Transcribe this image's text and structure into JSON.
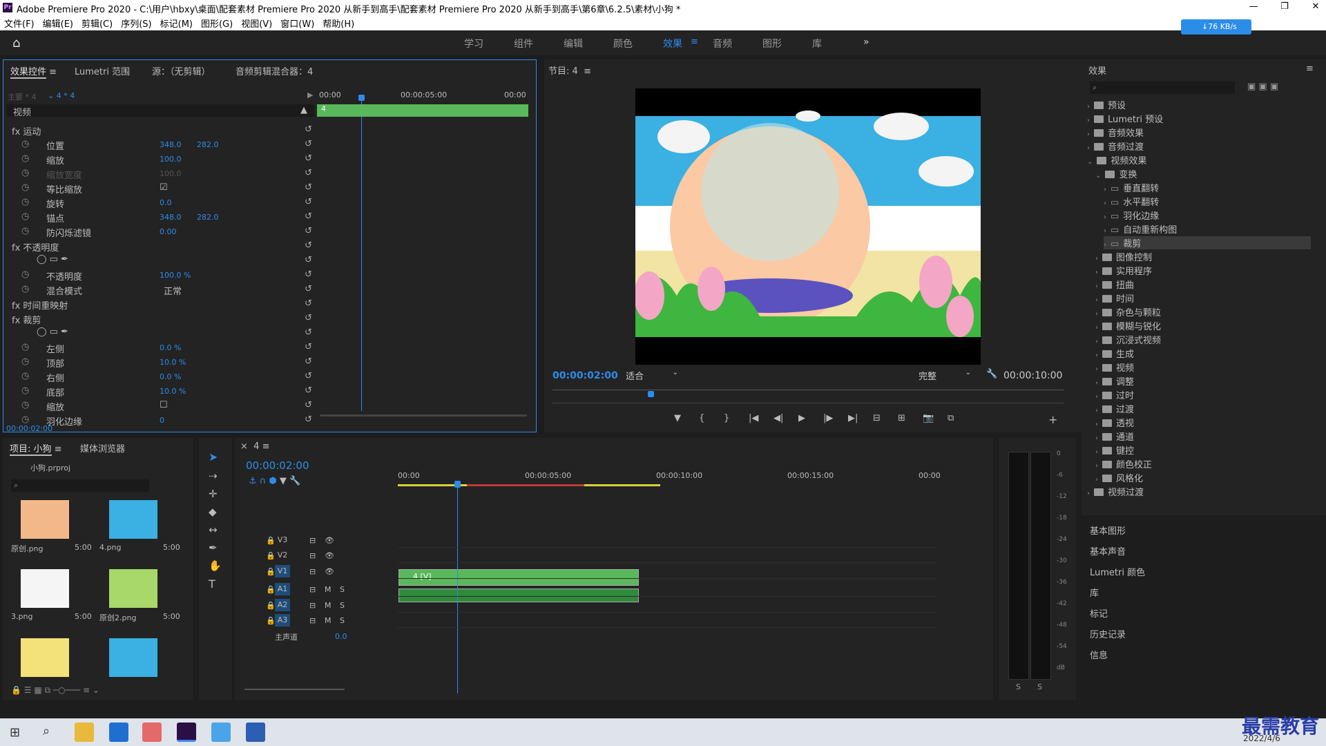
{
  "window": {
    "title": "Adobe Premiere Pro 2020 - C:\\用户\\hbxy\\桌面\\配套素材 Premiere Pro 2020 从新手到高手\\配套素材 Premiere Pro 2020 从新手到高手\\第6章\\6.2.5\\素材\\小狗 *",
    "logo": "Pr"
  },
  "menu": [
    "文件(F)",
    "编辑(E)",
    "剪辑(C)",
    "序列(S)",
    "标记(M)",
    "图形(G)",
    "视图(V)",
    "窗口(W)",
    "帮助(H)"
  ],
  "workspaces": [
    "学习",
    "组件",
    "编辑",
    "颜色",
    "效果",
    "音频",
    "图形",
    "库"
  ],
  "workspace_active": "效果",
  "workspace_menu_glyph": "≡",
  "more_glyph": "»",
  "net_speed": "↓76 KB/s",
  "effect_controls": {
    "tabs": [
      "效果控件",
      "Lumetri 范围",
      "源：（无剪辑）",
      "音频剪辑混合器：4"
    ],
    "tab_menu_glyph": "≡",
    "master_label": "主要 * 4",
    "clip_label": "4 * 4",
    "section_video": "视频",
    "timecodes": [
      "00:00",
      "00:00:05:00",
      "00:00"
    ],
    "clip_bar_label": "4",
    "rows": [
      {
        "name": "fx 运动",
        "indent": 0
      },
      {
        "name": "位置",
        "v1": "348.0",
        "v2": "282.0"
      },
      {
        "name": "缩放",
        "v1": "100.0"
      },
      {
        "name": "缩放宽度",
        "v1": "100.0",
        "dim": true
      },
      {
        "name": "等比缩放",
        "check": true
      },
      {
        "name": "旋转",
        "v1": "0.0"
      },
      {
        "name": "锚点",
        "v1": "348.0",
        "v2": "282.0"
      },
      {
        "name": "防闪烁滤镜",
        "v1": "0.00"
      },
      {
        "name": "fx 不透明度",
        "indent": 0
      },
      {
        "name": "",
        "shapes": true
      },
      {
        "name": "不透明度",
        "v1": "100.0 %"
      },
      {
        "name": "混合模式",
        "select": "正常"
      },
      {
        "name": "fx 时间重映射",
        "indent": 0
      },
      {
        "name": "fx 裁剪",
        "indent": 0
      },
      {
        "name": "",
        "shapes": true
      },
      {
        "name": "左侧",
        "v1": "0.0 %"
      },
      {
        "name": "顶部",
        "v1": "10.0 %"
      },
      {
        "name": "右侧",
        "v1": "0.0 %"
      },
      {
        "name": "底部",
        "v1": "10.0 %"
      },
      {
        "name": "缩放",
        "check": false
      },
      {
        "name": "羽化边缘",
        "v1": "0"
      }
    ],
    "current_time": "00:00:02:00"
  },
  "program": {
    "title": "节目: 4",
    "title_menu_glyph": "≡",
    "timecode": "00:00:02:00",
    "fit": "适合",
    "quality": "完整",
    "duration": "00:00:10:00",
    "wrench_glyph": "🔧",
    "controls": [
      "▼",
      "{",
      "}",
      "|◀",
      "◀|",
      "▶",
      "|▶",
      "▶|",
      "⊟",
      "⊞",
      "📷",
      "⧉"
    ],
    "add_glyph": "+"
  },
  "effects_panel": {
    "title": "效果",
    "menu_glyph": "≡",
    "items": [
      {
        "label": "预设",
        "level": 0,
        "open": false
      },
      {
        "label": "Lumetri 预设",
        "level": 0,
        "open": false
      },
      {
        "label": "音频效果",
        "level": 0,
        "open": false
      },
      {
        "label": "音频过渡",
        "level": 0,
        "open": false
      },
      {
        "label": "视频效果",
        "level": 0,
        "open": true
      },
      {
        "label": "变换",
        "level": 1,
        "open": true
      },
      {
        "label": "垂直翻转",
        "level": 2
      },
      {
        "label": "水平翻转",
        "level": 2
      },
      {
        "label": "羽化边缘",
        "level": 2
      },
      {
        "label": "自动重新构图",
        "level": 2
      },
      {
        "label": "裁剪",
        "level": 2,
        "selected": true
      },
      {
        "label": "图像控制",
        "level": 1
      },
      {
        "label": "实用程序",
        "level": 1
      },
      {
        "label": "扭曲",
        "level": 1
      },
      {
        "label": "时间",
        "level": 1
      },
      {
        "label": "杂色与颗粒",
        "level": 1
      },
      {
        "label": "模糊与锐化",
        "level": 1
      },
      {
        "label": "沉浸式视频",
        "level": 1
      },
      {
        "label": "生成",
        "level": 1
      },
      {
        "label": "视频",
        "level": 1
      },
      {
        "label": "调整",
        "level": 1
      },
      {
        "label": "过时",
        "level": 1
      },
      {
        "label": "过渡",
        "level": 1
      },
      {
        "label": "透视",
        "level": 1
      },
      {
        "label": "通道",
        "level": 1
      },
      {
        "label": "键控",
        "level": 1
      },
      {
        "label": "颜色校正",
        "level": 1
      },
      {
        "label": "风格化",
        "level": 1
      },
      {
        "label": "视频过渡",
        "level": 0
      }
    ],
    "side_panels": [
      "基本图形",
      "基本声音",
      "Lumetri 颜色",
      "库",
      "标记",
      "历史记录",
      "信息"
    ]
  },
  "project": {
    "tabs": [
      "项目: 小狗",
      "媒体浏览器"
    ],
    "tab_menu_glyph": "≡",
    "file": "小狗.prproj",
    "items": [
      {
        "name": "原创.png",
        "dur": "5:00"
      },
      {
        "name": "4.png",
        "dur": "5:00"
      },
      {
        "name": "3.png",
        "dur": "5:00"
      },
      {
        "name": "原创2.png",
        "dur": "5:00"
      },
      {
        "name": "",
        "dur": ""
      },
      {
        "name": "",
        "dur": ""
      }
    ]
  },
  "timeline": {
    "tab": "4",
    "close_glyph": "×",
    "menu_glyph": "≡",
    "timecode": "00:00:02:00",
    "ruler": [
      "00:00",
      "00:00:05:00",
      "00:00:10:00",
      "00:00:15:00",
      "00:00"
    ],
    "tracks": [
      {
        "name": "V3"
      },
      {
        "name": "V2"
      },
      {
        "name": "V1",
        "active": true
      },
      {
        "name": "A1",
        "active": true
      },
      {
        "name": "A2",
        "active": true
      },
      {
        "name": "A3",
        "active": true
      }
    ],
    "master": {
      "label": "主声道",
      "value": "0.0"
    },
    "clip_label": "4 [V]",
    "track_btns": {
      "mute": "M",
      "solo": "S"
    }
  },
  "meter": {
    "scale": [
      "0",
      "-6",
      "-12",
      "-18",
      "-24",
      "-30",
      "-36",
      "-42",
      "-48",
      "-54",
      "dB"
    ],
    "solo": [
      "S",
      "S"
    ]
  },
  "taskbar": {
    "date": "2022/4/6"
  },
  "watermark": "最需教育",
  "colors": {
    "accent": "#2d8ceb",
    "clip": "#59b85a",
    "panel": "#232323",
    "bg": "#1d1d1d"
  }
}
